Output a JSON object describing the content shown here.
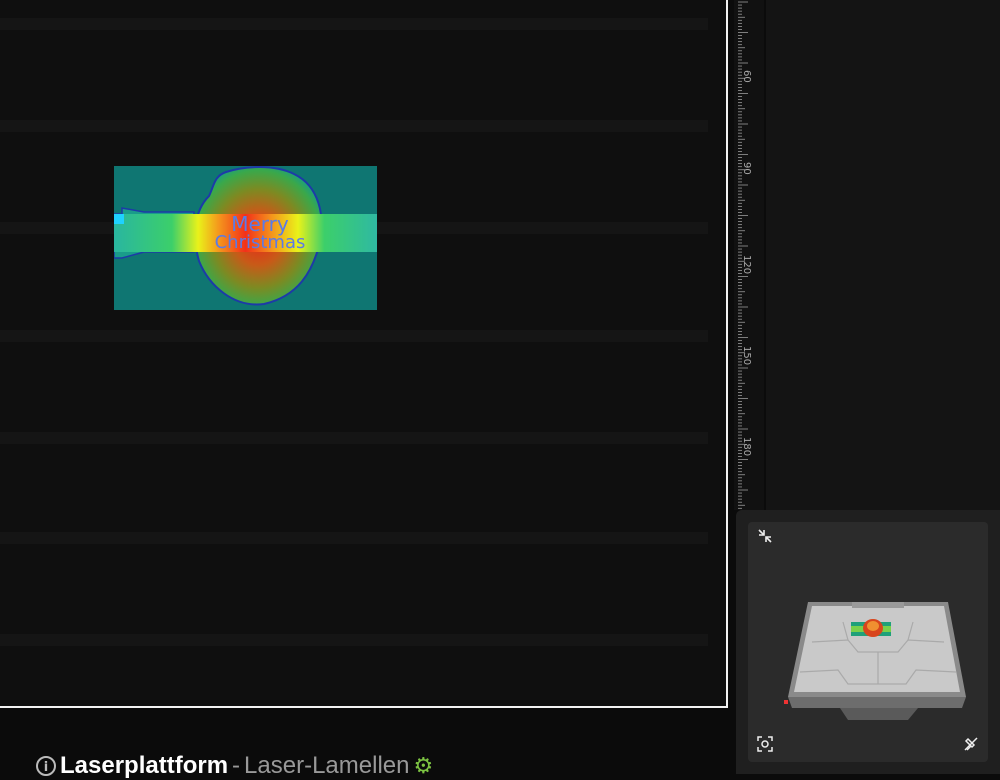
{
  "canvas": {
    "heatmap_text_line1": "Merry",
    "heatmap_text_line2": "Christmas"
  },
  "ruler": {
    "labels": [
      "60",
      "90",
      "120",
      "150",
      "180"
    ]
  },
  "preview": {
    "collapse_icon": "collapse-arrows-icon",
    "focus_icon": "focus-target-icon",
    "pin_icon": "pin-off-icon"
  },
  "project": {
    "title": "Laserplattform",
    "separator": "-",
    "subtitle": "Laser-Lamellen",
    "settings_icon": "gear-icon",
    "info_icon": "info-icon"
  },
  "colors": {
    "canvas_bg": "#0f0f0f",
    "canvas_border": "#f2f2f2",
    "accent_green": "#7cc242"
  }
}
